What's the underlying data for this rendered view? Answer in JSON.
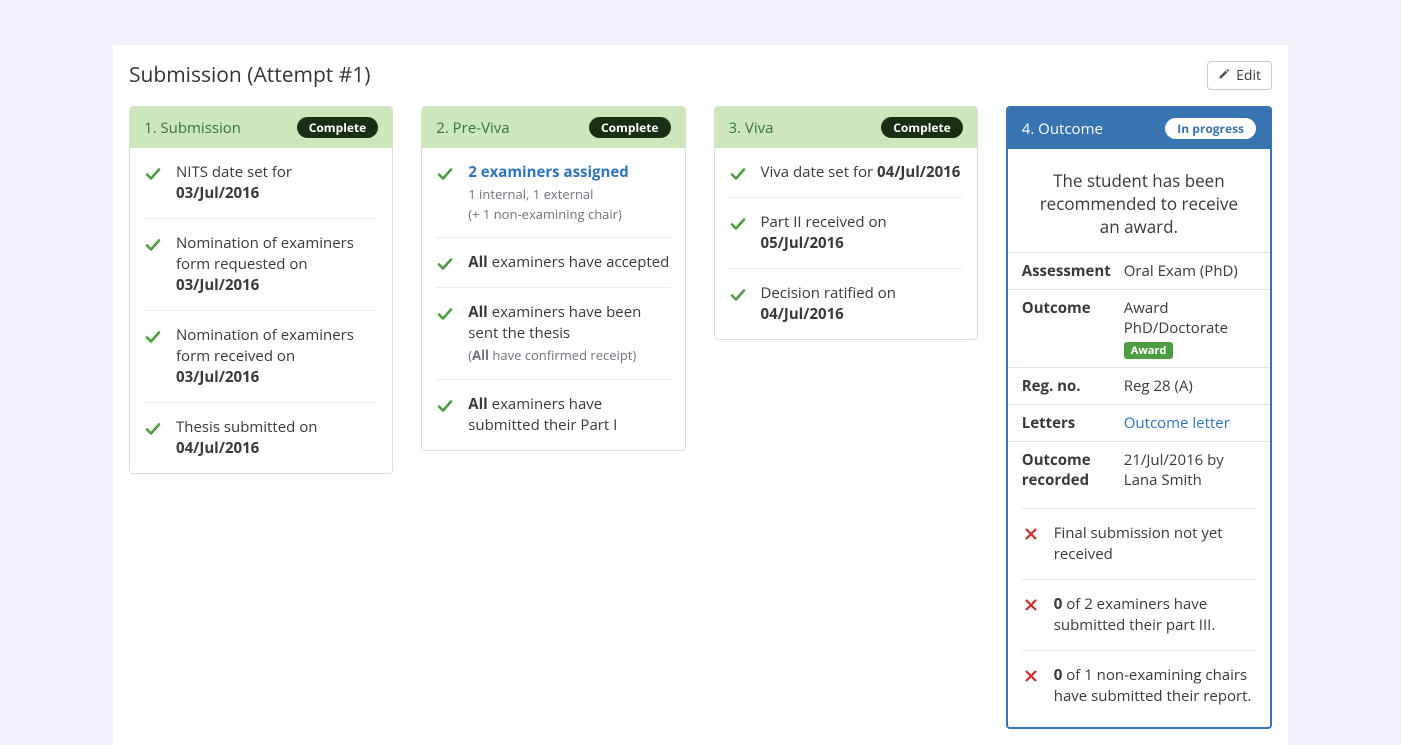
{
  "page": {
    "title": "Submission (Attempt #1)",
    "edit_label": "Edit"
  },
  "cards": [
    {
      "title": "1. Submission",
      "status": "Complete",
      "status_class": "complete",
      "color": "green",
      "items": [
        {
          "icon": "check",
          "html": "NITS date set for <b>03/Jul/2016</b>"
        },
        {
          "icon": "check",
          "html": "Nomination of examiners form requested on <b>03/Jul/2016</b>"
        },
        {
          "icon": "check",
          "html": "Nomination of examiners form received on <b>03/Jul/2016</b>"
        },
        {
          "icon": "check",
          "html": "Thesis submitted on <b>04/Jul/2016</b>"
        }
      ]
    },
    {
      "title": "2. Pre-Viva",
      "status": "Complete",
      "status_class": "complete",
      "color": "green",
      "items": [
        {
          "icon": "check",
          "link": "2 examiners assigned",
          "sub1": "1 internal, 1 external",
          "sub2": "(+ 1 non-examining chair)",
          "interactable": true
        },
        {
          "icon": "check",
          "html": "<b>All</b> examiners have accepted"
        },
        {
          "icon": "check",
          "html": "<b>All</b> examiners have been sent the thesis",
          "subhtml": "(<b>All</b> have confirmed receipt)"
        },
        {
          "icon": "check",
          "html": "<b>All</b> examiners have submitted their Part I"
        }
      ]
    },
    {
      "title": "3. Viva",
      "status": "Complete",
      "status_class": "complete",
      "color": "green",
      "items": [
        {
          "icon": "check",
          "html": "Viva date set for <b>04/Jul/2016</b>"
        },
        {
          "icon": "check",
          "html": "Part II received on <b>05/Jul/2016</b>"
        },
        {
          "icon": "check",
          "html": "Decision ratified on <b>04/Jul/2016</b>"
        }
      ]
    }
  ],
  "outcome": {
    "title": "4. Outcome",
    "status": "In progress",
    "status_class": "inprogress",
    "message": "The student has been recommended to receive an award.",
    "rows": [
      {
        "label": "Assessment",
        "value": "Oral Exam (PhD)"
      },
      {
        "label": "Outcome",
        "value": "Award PhD/Doctorate",
        "award_chip": "Award"
      },
      {
        "label": "Reg. no.",
        "value": "Reg 28 (A)"
      },
      {
        "label": "Letters",
        "value": "Outcome letter",
        "is_link": true
      },
      {
        "label": "Outcome recorded",
        "value": "21/Jul/2016 by Lana Smith"
      }
    ],
    "checks": [
      {
        "icon": "cross",
        "html": "Final submission not yet received"
      },
      {
        "icon": "cross",
        "html": "<b>0</b> of 2 examiners have submitted their part III."
      },
      {
        "icon": "cross",
        "html": "<b>0</b> of 1 non-examining chairs have submitted their report."
      }
    ]
  }
}
